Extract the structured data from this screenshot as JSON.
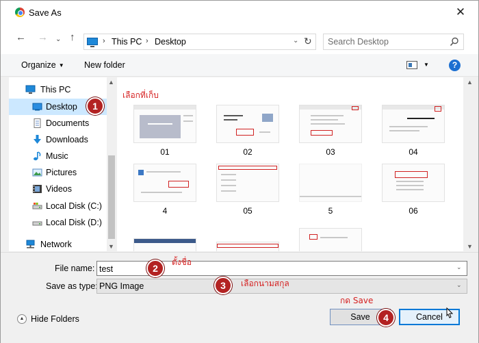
{
  "window": {
    "title": "Save As",
    "close_glyph": "✕",
    "app_icon": "chrome-icon"
  },
  "nav": {
    "back_glyph": "←",
    "forward_glyph": "→",
    "recent_glyph": "⌄",
    "up_glyph": "↑",
    "breadcrumb": [
      "This PC",
      "Desktop"
    ],
    "breadcrumb_sep": "›",
    "dropdown_glyph": "⌄",
    "refresh_glyph": "↻",
    "search_placeholder": "Search Desktop"
  },
  "toolbar": {
    "organize": "Organize",
    "organize_caret": "▼",
    "new_folder": "New folder",
    "view_caret": "▼",
    "help": "?"
  },
  "sidebar": {
    "items": [
      {
        "label": "This PC",
        "icon": "pc-icon"
      },
      {
        "label": "Desktop",
        "icon": "desktop-icon",
        "selected": true
      },
      {
        "label": "Documents",
        "icon": "documents-icon"
      },
      {
        "label": "Downloads",
        "icon": "downloads-icon"
      },
      {
        "label": "Music",
        "icon": "music-icon"
      },
      {
        "label": "Pictures",
        "icon": "pictures-icon"
      },
      {
        "label": "Videos",
        "icon": "videos-icon"
      },
      {
        "label": "Local Disk (C:)",
        "icon": "disk-c-icon"
      },
      {
        "label": "Local Disk (D:)",
        "icon": "disk-d-icon"
      },
      {
        "label": "Network",
        "icon": "network-icon"
      }
    ],
    "scroll_up": "▲",
    "scroll_down": "▼"
  },
  "files": [
    "01",
    "02",
    "03",
    "04",
    "4",
    "05",
    "5",
    "06"
  ],
  "form": {
    "file_name_label": "File name:",
    "file_name_value": "test",
    "save_type_label": "Save as type:",
    "save_type_value": "PNG Image",
    "dropdown_glyph": "⌄"
  },
  "footer": {
    "hide_folders": "Hide Folders",
    "hide_glyph": "▲",
    "save": "Save",
    "cancel": "Cancel"
  },
  "annotations": {
    "badges": [
      "1",
      "2",
      "3",
      "4"
    ],
    "notes": [
      "เลือกที่เก็บ",
      "ตั้งชื่อ",
      "เลือกนามสกุล",
      "กด Save"
    ],
    "color": "#d51f1f"
  },
  "colors": {
    "selection": "#cce8ff",
    "accent": "#0078d7",
    "badge": "#b32222"
  }
}
